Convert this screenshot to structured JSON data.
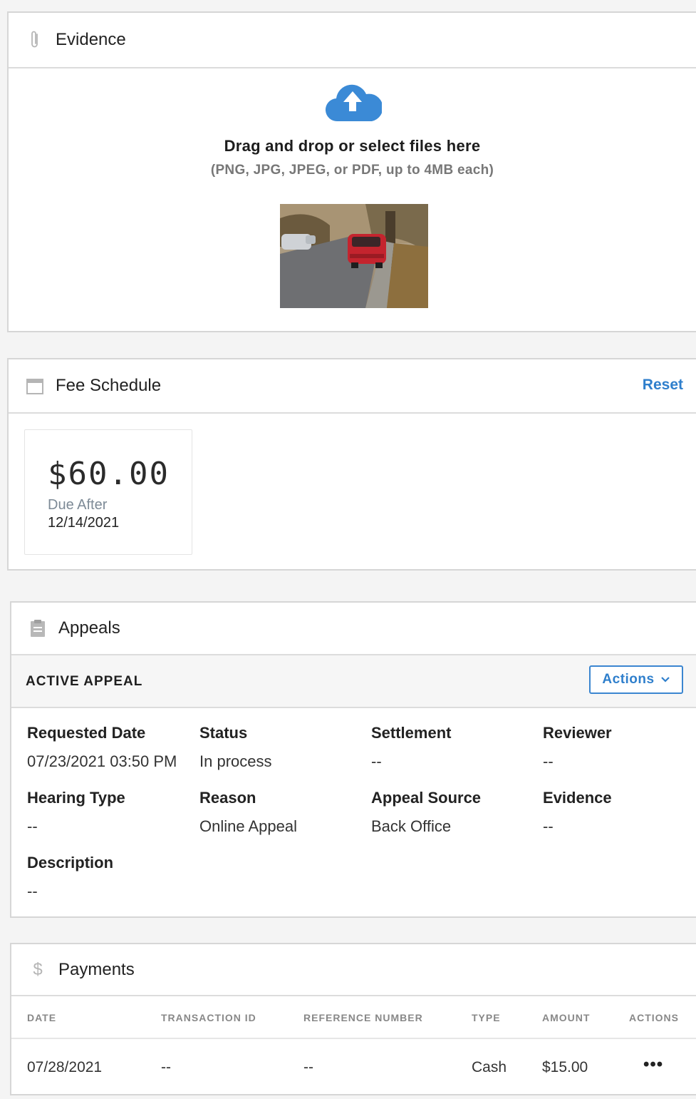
{
  "evidence": {
    "title": "Evidence",
    "icon": "paperclip-icon",
    "upload_icon": "cloud-upload-icon",
    "drop_title": "Drag and drop or select files here",
    "drop_hint": "(PNG, JPG, JPEG, or PDF, up to 4MB each)",
    "accent_color": "#3b8ad6"
  },
  "fee_schedule": {
    "title": "Fee Schedule",
    "icon": "calendar-icon",
    "reset_label": "Reset",
    "amount": "$60.00",
    "due_label": "Due After",
    "due_date": "12/14/2021"
  },
  "appeals": {
    "title": "Appeals",
    "icon": "clipboard-icon",
    "active_title": "ACTIVE APPEAL",
    "actions_label": "Actions",
    "fields": {
      "requested_date": {
        "label": "Requested Date",
        "value": "07/23/2021 03:50 PM"
      },
      "status": {
        "label": "Status",
        "value": "In process"
      },
      "settlement": {
        "label": "Settlement",
        "value": "--"
      },
      "reviewer": {
        "label": "Reviewer",
        "value": "--"
      },
      "hearing_type": {
        "label": "Hearing Type",
        "value": "--"
      },
      "reason": {
        "label": "Reason",
        "value": "Online Appeal"
      },
      "appeal_source": {
        "label": "Appeal Source",
        "value": "Back Office"
      },
      "evidence": {
        "label": "Evidence",
        "value": "--"
      },
      "description": {
        "label": "Description",
        "value": "--"
      }
    }
  },
  "payments": {
    "title": "Payments",
    "icon": "dollar-icon",
    "columns": {
      "date": "DATE",
      "transaction_id": "TRANSACTION ID",
      "reference_number": "REFERENCE NUMBER",
      "type": "TYPE",
      "amount": "AMOUNT",
      "actions": "ACTIONS"
    },
    "rows": [
      {
        "date": "07/28/2021",
        "transaction_id": "--",
        "reference_number": "--",
        "type": "Cash",
        "amount": "$15.00",
        "actions": "•••"
      }
    ]
  }
}
